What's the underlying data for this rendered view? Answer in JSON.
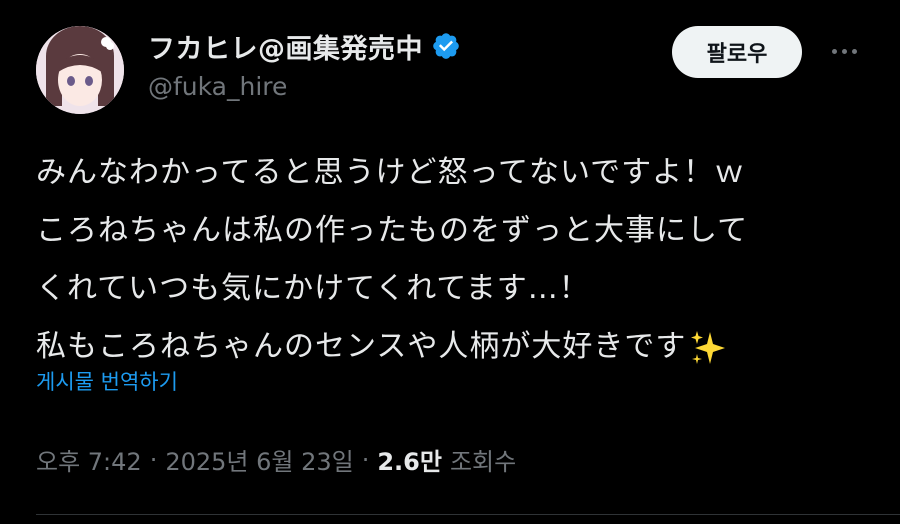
{
  "author": {
    "display_name": "フカヒレ@画集発売中",
    "handle": "@fuka_hire",
    "verified": true
  },
  "actions": {
    "follow_label": "팔로우"
  },
  "tweet": {
    "lines": [
      "みんなわかってると思うけど怒ってないですよ！ｗ",
      "ころねちゃんは私の作ったものをずっと大事にして",
      "くれていつも気にかけてくれてます…！",
      "私もころねちゃんのセンスや人柄が大好きです"
    ],
    "emoji": "sparkles",
    "translate_label": "게시물 번역하기"
  },
  "meta": {
    "time": "오후 7:42",
    "separator": "·",
    "date": "2025년 6월 23일",
    "views_count": "2.6만",
    "views_label": "조회수"
  },
  "colors": {
    "background": "#000000",
    "text": "#e7e9ea",
    "muted": "#71767b",
    "link": "#1d9bf0",
    "verified": "#1d9bf0",
    "button_bg": "#eff3f4"
  }
}
